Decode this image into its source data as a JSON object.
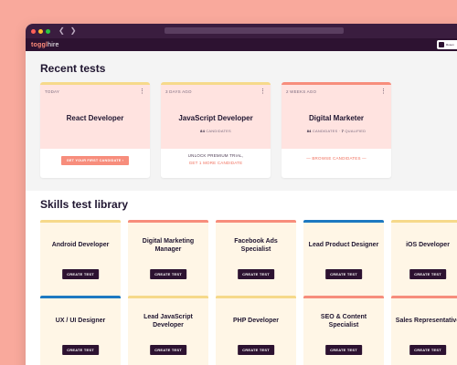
{
  "browser": {
    "dot_colors": [
      "#ff6159",
      "#ffbd2e",
      "#28c941"
    ],
    "back_icon": "chevron-left-icon",
    "forward_icon": "chevron-right-icon"
  },
  "app": {
    "logo_brand": "toggl",
    "logo_product": "hire",
    "account_label": "Rosen"
  },
  "recent": {
    "title": "Recent tests",
    "cards": [
      {
        "date": "TODAY",
        "name": "React Developer",
        "action": "GET YOUR FIRST CANDIDATE ›"
      },
      {
        "date": "3 DAYS AGO",
        "name": "JavaScript Developer",
        "count": "84",
        "count_label": "CANDIDATES",
        "unlock": "UNLOCK PREMIUM TRIAL,",
        "link": "GET 1 MORE CANDIDATE"
      },
      {
        "date": "2 WEEKS AGO",
        "name": "Digital Marketer",
        "count": "84",
        "count_label": "CANDIDATES",
        "sep": "·",
        "qualified": "7",
        "qualified_label": "QUALIFIED",
        "link": "— BROWSE CANDIDATES —"
      }
    ]
  },
  "library": {
    "title": "Skills test library",
    "button_label": "CREATE TEST",
    "items": [
      {
        "name": "Android Developer",
        "accent": "yellow"
      },
      {
        "name": "Digital Marketing Manager",
        "accent": "salmon"
      },
      {
        "name": "Facebook Ads Specialist",
        "accent": "salmon"
      },
      {
        "name": "Lead Product Designer",
        "accent": "blue"
      },
      {
        "name": "iOS Developer",
        "accent": "yellow"
      },
      {
        "name": "UX / UI Designer",
        "accent": "blue"
      },
      {
        "name": "Lead JavaScript Developer",
        "accent": "yellow"
      },
      {
        "name": "PHP Developer",
        "accent": "yellow"
      },
      {
        "name": "SEO & Content Specialist",
        "accent": "salmon"
      },
      {
        "name": "Sales Representative",
        "accent": "salmon"
      }
    ]
  }
}
